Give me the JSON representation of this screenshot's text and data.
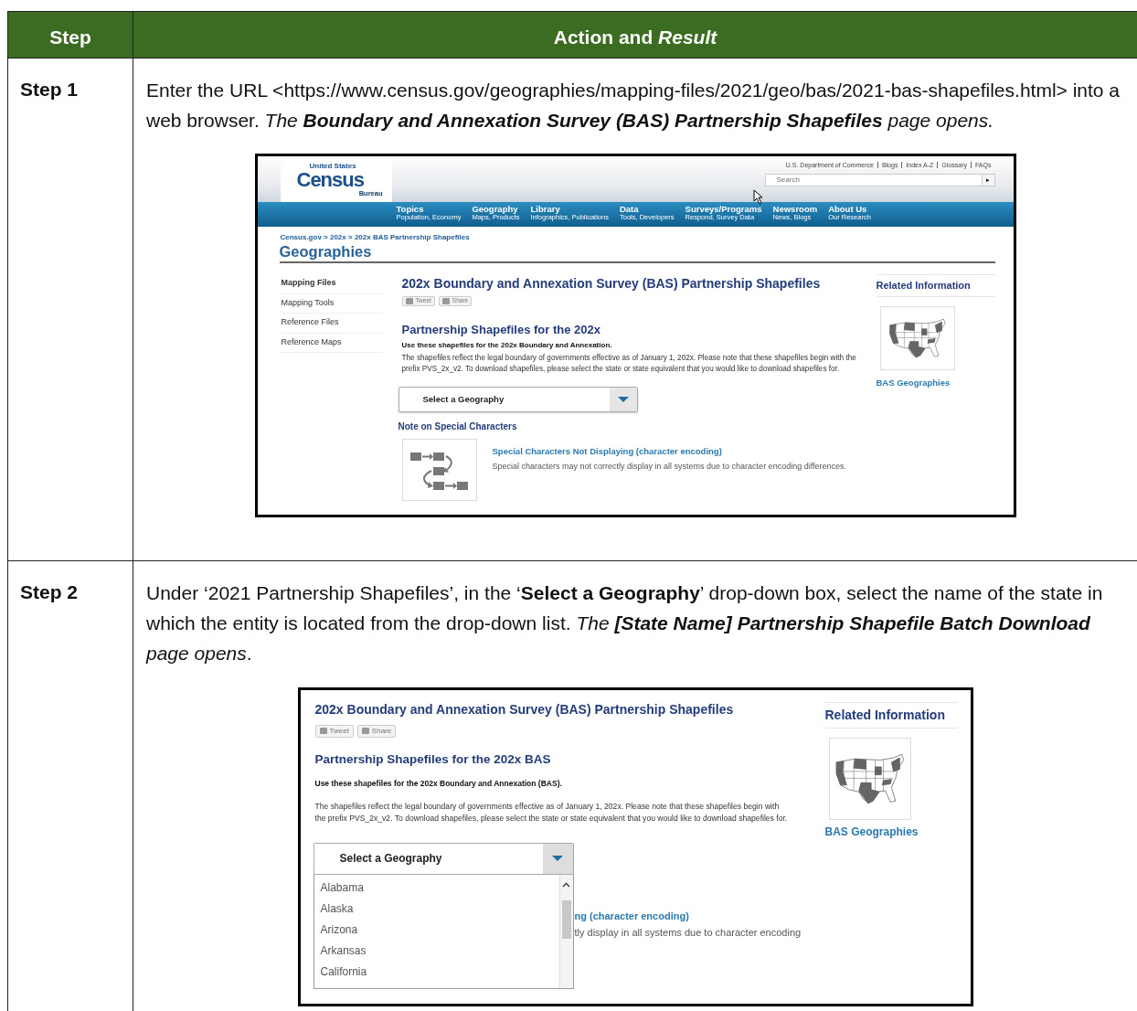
{
  "table_header": {
    "step": "Step",
    "action": "Action and *Result*"
  },
  "steps": [
    {
      "label": "Step 1",
      "instruction": [
        {
          "kind": "text",
          "text": "Enter the URL <"
        },
        {
          "kind": "link",
          "text": "https://www.census.gov/geographies/mapping-files/2021/geo/bas/2021-bas-shapefiles.html"
        },
        {
          "kind": "text",
          "text": "> into a web browser. *The*"
        },
        {
          "kind": "emphasis",
          "text": "Boundary and Annexation Survey (BAS) Partnership Shapefiles"
        },
        {
          "kind": "text",
          "text": "*page opens.*"
        }
      ],
      "screenshot": {
        "kind": "full_page",
        "header": {
          "utility_links": [
            "U.S. Department of Commerce",
            "Blogs",
            "Index A-Z",
            "Glossary",
            "FAQs"
          ],
          "logo": {
            "top": "United States",
            "main": "Census",
            "bottom": "Bureau"
          },
          "search": {
            "placeholder": "Search",
            "button": "▸"
          },
          "nav": [
            {
              "title": "Topics",
              "sub": "Population, Economy"
            },
            {
              "title": "Geography",
              "sub": "Maps, Products"
            },
            {
              "title": "Library",
              "sub": "Infographics, Publications"
            },
            {
              "title": "Data",
              "sub": "Tools, Developers"
            },
            {
              "title": "Surveys/Programs",
              "sub": "Respond, Survey Data"
            },
            {
              "title": "Newsroom",
              "sub": "News, Blogs"
            },
            {
              "title": "About Us",
              "sub": "Our Research"
            }
          ]
        },
        "breadcrumb": "Census.gov > 202x > 202x BAS Partnership Shapefiles",
        "section_title": "Geographies",
        "sidebar": [
          {
            "label": "Mapping Files",
            "selected": true
          },
          {
            "label": "Mapping Tools",
            "selected": false
          },
          {
            "label": "Reference Files",
            "selected": false
          },
          {
            "label": "Reference Maps",
            "selected": false
          }
        ],
        "page_title": "202x Boundary and Annexation Survey (BAS) Partnership Shapefiles",
        "share_buttons": [
          "Tweet",
          "Share"
        ],
        "heading": "Partnership Shapefiles for the 202x",
        "lead": "Use these shapefiles for the 202x Boundary and Annexation.",
        "body": "The shapefiles reflect the legal boundary of governments effective as of January 1, 202x. Please note that these shapefiles begin with the prefix PVS_2x_v2. To download shapefiles, please select the state or state equivalent that you would like to download shapefiles for.",
        "select": {
          "label": "Select a Geography",
          "expanded": false
        },
        "note": {
          "heading": "Note on Special Characters",
          "link": "Special Characters Not Displaying (character encoding)",
          "text": "Special characters may not correctly display in all systems due to character encoding differences."
        },
        "related": {
          "title": "Related Information",
          "link": "BAS Geographies"
        }
      }
    },
    {
      "label": "Step 2",
      "instruction": [
        {
          "kind": "text",
          "text": "Under ‘2021 Partnership Shapefiles’, in the ‘**Select a Geography**’ drop-down box, select the name of the state in which the entity is located from the drop-down list. *The*"
        },
        {
          "kind": "emphasis",
          "text": "[State Name] Partnership Shapefile Batch Download"
        },
        {
          "kind": "text",
          "text": "*page opens*."
        }
      ],
      "screenshot": {
        "kind": "cropped_page",
        "page_title": "202x Boundary and Annexation Survey (BAS) Partnership Shapefiles",
        "share_buttons": [
          "Tweet",
          "Share"
        ],
        "heading": "Partnership Shapefiles for the 202x BAS",
        "lead": "Use these shapefiles for the 202x Boundary and Annexation (BAS).",
        "body": "The shapefiles reflect the legal boundary of governments effective as of January 1, 202x. Please note that these shapefiles begin with the prefix PVS_2x_v2. To download shapefiles, please select the state or state equivalent that you would like to download shapefiles for.",
        "select": {
          "label": "Select a Geography",
          "expanded": true,
          "options": [
            "Alabama",
            "Alaska",
            "Arizona",
            "Arkansas",
            "California"
          ]
        },
        "partial_texts": [
          {
            "kind": "link",
            "text": "ng (character encoding)"
          },
          {
            "kind": "text",
            "text": "tly display in all systems due to character encoding"
          }
        ],
        "related": {
          "title": "Related Information",
          "link": "BAS Geographies"
        }
      }
    }
  ]
}
